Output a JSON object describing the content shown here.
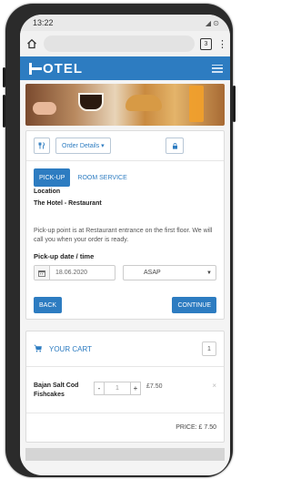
{
  "status_bar": {
    "time": "13:22",
    "icons": "◢ ⊙"
  },
  "browser": {
    "tab_count": "3",
    "url": ""
  },
  "navbar": {
    "brand": "OTEL"
  },
  "toolbar": {
    "order_details_label": "Order Details ▾"
  },
  "order": {
    "tabs": [
      {
        "label": "PICK-UP",
        "active": true
      },
      {
        "label": "ROOM SERVICE",
        "active": false
      }
    ],
    "location_label": "Location",
    "location_name": "The Hotel - Restaurant",
    "info_text": "Pick-up point is at Restaurant entrance on the first floor. We will call you when your order is ready.",
    "pickup_label": "Pick-up date / time",
    "date_value": "18.06.2020",
    "time_value": "ASAP",
    "back_label": "BACK",
    "continue_label": "CONTINUE"
  },
  "cart": {
    "title": "YOUR CART",
    "count": "1",
    "items": [
      {
        "name": "Bajan Salt Cod Fishcakes",
        "quantity": "1",
        "price": "£7.50"
      }
    ],
    "total": "PRICE: £ 7.50"
  },
  "colors": {
    "primary": "#2d7cc1",
    "navbar": "#2d7cc1"
  }
}
